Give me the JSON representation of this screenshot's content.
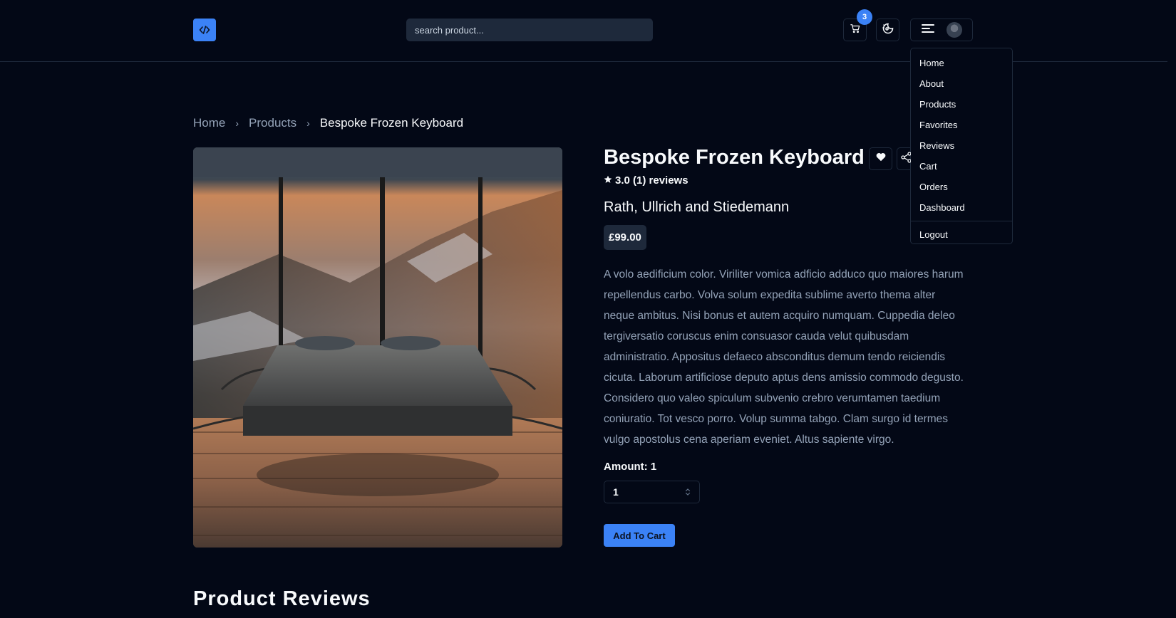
{
  "header": {
    "search_placeholder": "search product...",
    "cart_count": "3"
  },
  "menu": {
    "items": [
      "Home",
      "About",
      "Products",
      "Favorites",
      "Reviews",
      "Cart",
      "Orders",
      "Dashboard"
    ],
    "logout": "Logout"
  },
  "breadcrumb": [
    "Home",
    "Products",
    "Bespoke Frozen Keyboard"
  ],
  "product": {
    "title": "Bespoke Frozen Keyboard",
    "rating": "3.0 (1) reviews",
    "brand": "Rath, Ullrich and Stiedemann",
    "price": "£99.00",
    "description": "A volo aedificium color. Viriliter vomica adficio adduco quo maiores harum repellendus carbo. Volva solum expedita sublime averto thema alter neque ambitus. Nisi bonus et autem acquiro numquam. Cuppedia deleo tergiversatio coruscus enim consuasor cauda velut quibusdam administratio. Appositus defaeco absconditus demum tendo reiciendis cicuta. Laborum artificiose deputo aptus dens amissio commodo degusto. Considero quo valeo spiculum subvenio crebro verumtamen taedium coniuratio. Tot vesco porro. Volup summa tabgo. Clam surgo id termes vulgo apostolus cena aperiam eveniet. Altus sapiente virgo.",
    "amount_label": "Amount: 1",
    "quantity": "1",
    "add_to_cart": "Add To Cart"
  },
  "reviews": {
    "heading": "Product Reviews"
  },
  "colors": {
    "background": "#030816",
    "accent": "#3b82f6",
    "border": "#1e293b",
    "muted_text": "#94a3b8"
  }
}
